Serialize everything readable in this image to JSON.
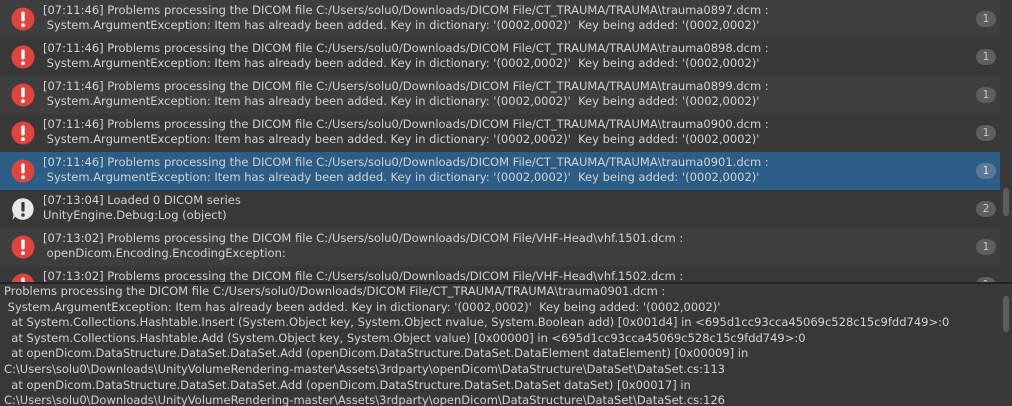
{
  "console": {
    "entries": [
      {
        "type": "error",
        "line1": "[07:11:46] Problems processing the DICOM file C:/Users/solu0/Downloads/DICOM File/CT_TRAUMA/TRAUMA\\trauma0897.dcm :",
        "line2": " System.ArgumentException: Item has already been added. Key in dictionary: '(0002,0002)'  Key being added: '(0002,0002)'",
        "count": "1",
        "selected": false
      },
      {
        "type": "error",
        "line1": "[07:11:46] Problems processing the DICOM file C:/Users/solu0/Downloads/DICOM File/CT_TRAUMA/TRAUMA\\trauma0898.dcm :",
        "line2": " System.ArgumentException: Item has already been added. Key in dictionary: '(0002,0002)'  Key being added: '(0002,0002)'",
        "count": "1",
        "selected": false
      },
      {
        "type": "error",
        "line1": "[07:11:46] Problems processing the DICOM file C:/Users/solu0/Downloads/DICOM File/CT_TRAUMA/TRAUMA\\trauma0899.dcm :",
        "line2": " System.ArgumentException: Item has already been added. Key in dictionary: '(0002,0002)'  Key being added: '(0002,0002)'",
        "count": "1",
        "selected": false
      },
      {
        "type": "error",
        "line1": "[07:11:46] Problems processing the DICOM file C:/Users/solu0/Downloads/DICOM File/CT_TRAUMA/TRAUMA\\trauma0900.dcm :",
        "line2": " System.ArgumentException: Item has already been added. Key in dictionary: '(0002,0002)'  Key being added: '(0002,0002)'",
        "count": "1",
        "selected": false
      },
      {
        "type": "error",
        "line1": "[07:11:46] Problems processing the DICOM file C:/Users/solu0/Downloads/DICOM File/CT_TRAUMA/TRAUMA\\trauma0901.dcm :",
        "line2": " System.ArgumentException: Item has already been added. Key in dictionary: '(0002,0002)'  Key being added: '(0002,0002)'",
        "count": "1",
        "selected": true
      },
      {
        "type": "info",
        "line1": "[07:13:04] Loaded 0 DICOM series",
        "line2": "UnityEngine.Debug:Log (object)",
        "count": "2",
        "selected": false
      },
      {
        "type": "error",
        "line1": "[07:13:02] Problems processing the DICOM file C:/Users/solu0/Downloads/DICOM File/VHF-Head\\vhf.1501.dcm :",
        "line2": " openDicom.Encoding.EncodingException:",
        "count": "1",
        "selected": false
      },
      {
        "type": "error",
        "line1": "[07:13:02] Problems processing the DICOM file C:/Users/solu0/Downloads/DICOM File/VHF-Head\\vhf.1502.dcm :",
        "line2": "",
        "count": "1",
        "selected": false
      }
    ]
  },
  "detail": {
    "lines": [
      "Problems processing the DICOM file C:/Users/solu0/Downloads/DICOM File/CT_TRAUMA/TRAUMA\\trauma0901.dcm :",
      " System.ArgumentException: Item has already been added. Key in dictionary: '(0002,0002)'  Key being added: '(0002,0002)'",
      "  at System.Collections.Hashtable.Insert (System.Object key, System.Object nvalue, System.Boolean add) [0x001d4] in <695d1cc93cca45069c528c15c9fdd749>:0",
      "  at System.Collections.Hashtable.Add (System.Object key, System.Object value) [0x00000] in <695d1cc93cca45069c528c15c9fdd749>:0",
      "  at openDicom.DataStructure.DataSet.DataSet.Add (openDicom.DataStructure.DataSet.DataElement dataElement) [0x00009] in",
      "C:\\Users\\solu0\\Downloads\\UnityVolumeRendering-master\\Assets\\3rdparty\\openDicom\\DataStructure\\DataSet\\DataSet.cs:113",
      "  at openDicom.DataStructure.DataSet.DataSet.Add (openDicom.DataStructure.DataSet.DataSet dataSet) [0x00017] in",
      "C:\\Users\\solu0\\Downloads\\UnityVolumeRendering-master\\Assets\\3rdparty\\openDicom\\DataStructure\\DataSet\\DataSet.cs:126"
    ]
  },
  "colors": {
    "error_icon": "#e0443c",
    "info_icon": "#e8e8e8",
    "selection": "#2c5d87"
  }
}
